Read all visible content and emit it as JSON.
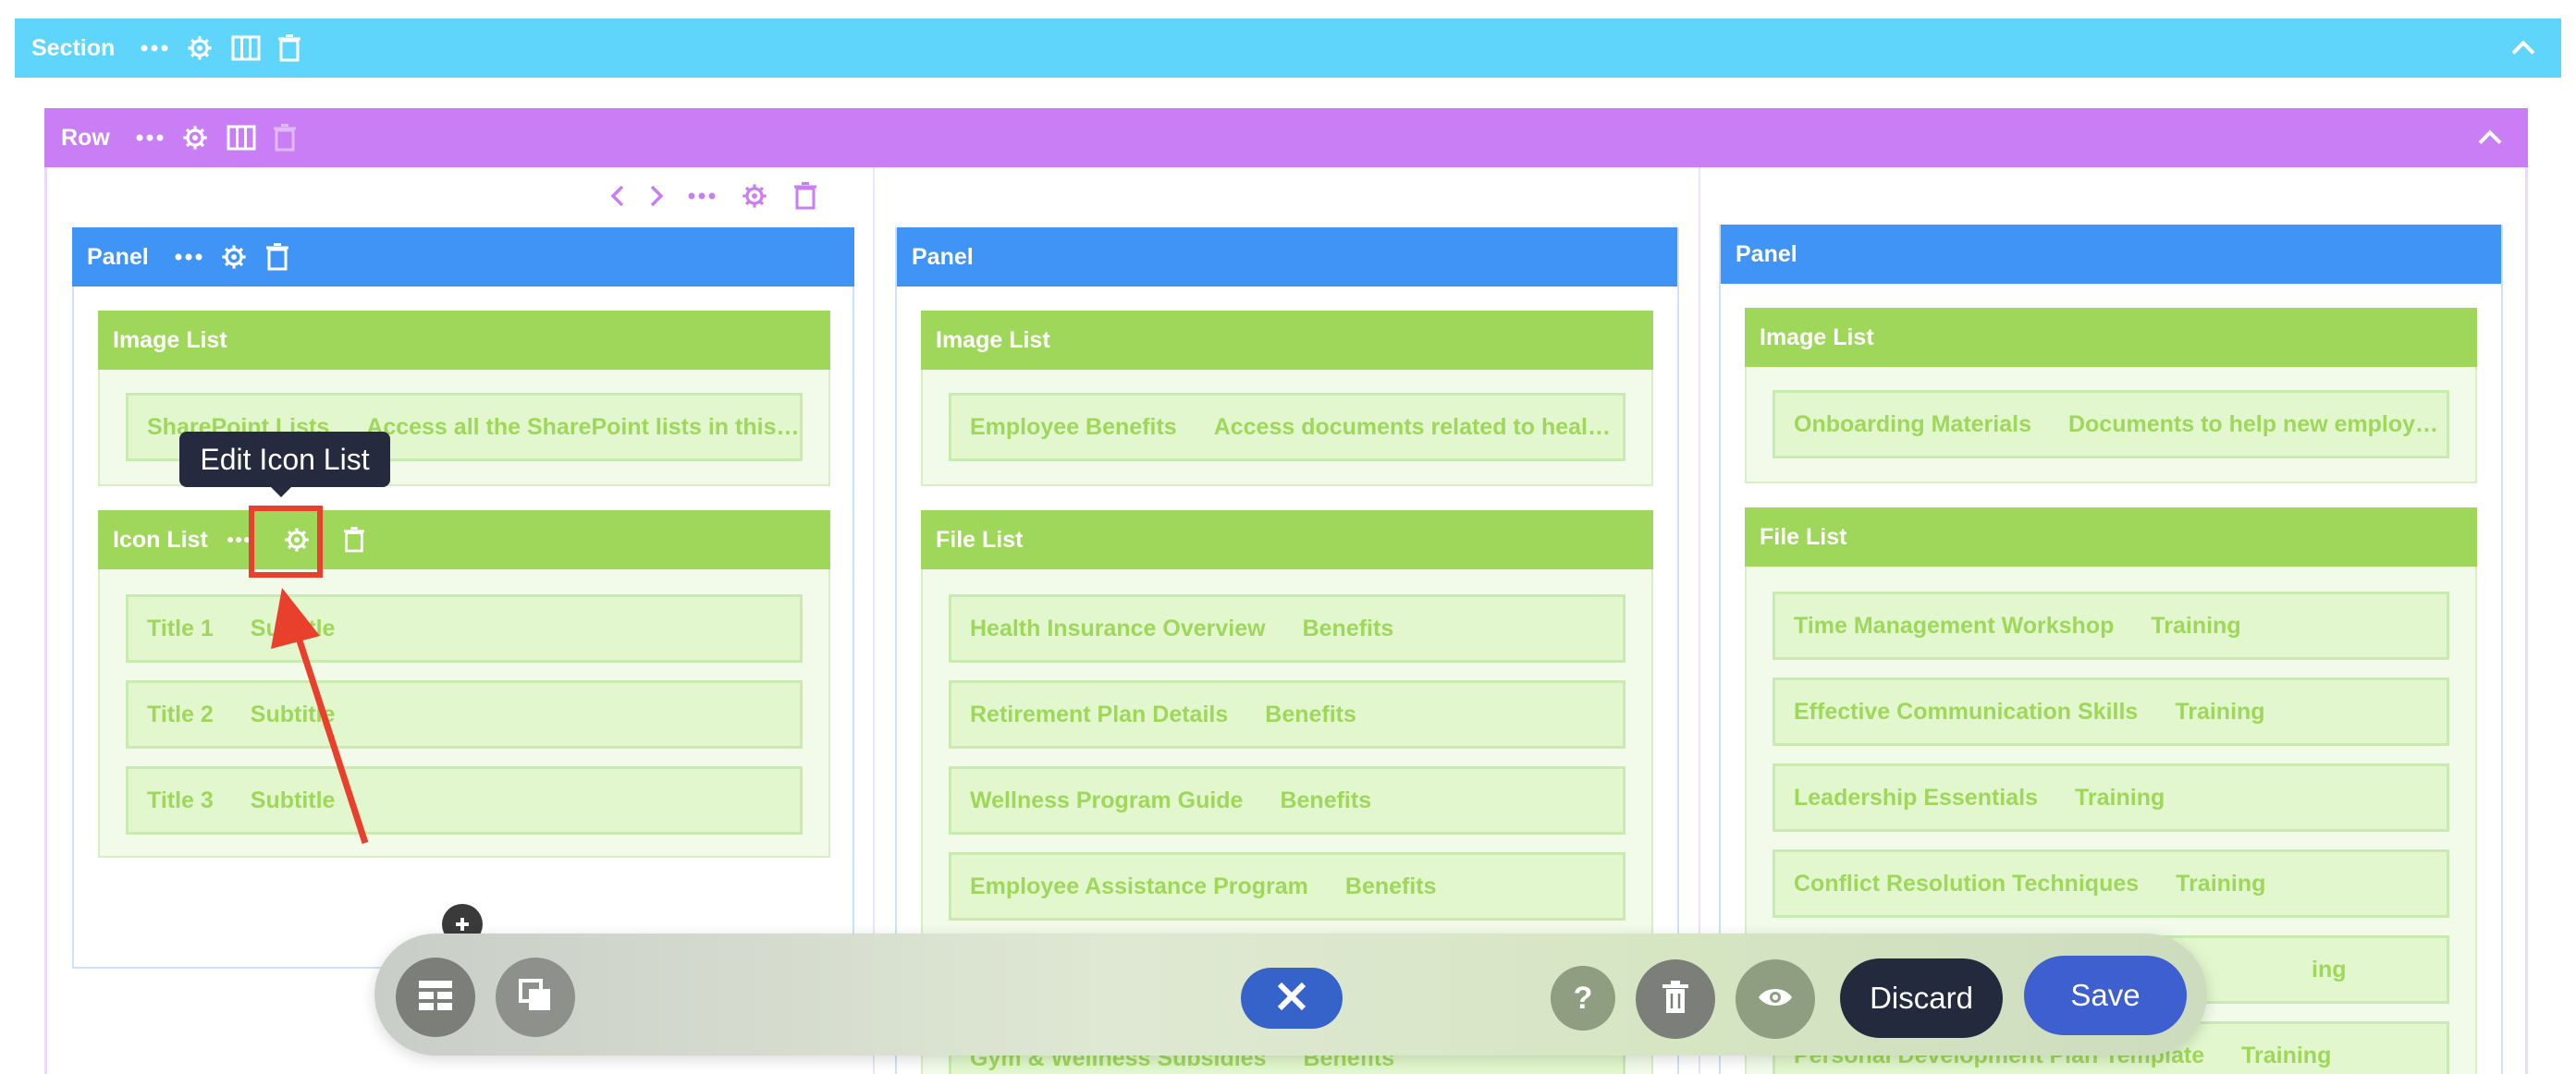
{
  "section": {
    "label": "Section"
  },
  "row": {
    "label": "Row"
  },
  "panels": [
    {
      "label": "Panel",
      "image_list": {
        "label": "Image List",
        "item": {
          "title": "SharePoint Lists",
          "subtitle": "Access all the SharePoint lists in this…"
        }
      },
      "icon_list": {
        "label": "Icon List",
        "items": [
          {
            "title": "Title 1",
            "subtitle": "Subtitle"
          },
          {
            "title": "Title 2",
            "subtitle": "Subtitle"
          },
          {
            "title": "Title 3",
            "subtitle": "Subtitle"
          }
        ]
      }
    },
    {
      "label": "Panel",
      "image_list": {
        "label": "Image List",
        "item": {
          "title": "Employee Benefits",
          "subtitle": "Access documents related to heal…"
        }
      },
      "file_list": {
        "label": "File List",
        "items": [
          {
            "title": "Health Insurance Overview",
            "subtitle": "Benefits"
          },
          {
            "title": "Retirement Plan Details",
            "subtitle": "Benefits"
          },
          {
            "title": "Wellness Program Guide",
            "subtitle": "Benefits"
          },
          {
            "title": "Employee Assistance Program",
            "subtitle": "Benefits"
          },
          {
            "title": "",
            "subtitle": ""
          },
          {
            "title": "Gym & Wellness Subsidies",
            "subtitle": "Benefits"
          }
        ]
      }
    },
    {
      "label": "Panel",
      "image_list": {
        "label": "Image List",
        "item": {
          "title": "Onboarding Materials",
          "subtitle": "Documents to help new employ…"
        }
      },
      "file_list": {
        "label": "File List",
        "items": [
          {
            "title": "Time Management Workshop",
            "subtitle": "Training"
          },
          {
            "title": "Effective Communication Skills",
            "subtitle": "Training"
          },
          {
            "title": "Leadership Essentials",
            "subtitle": "Training"
          },
          {
            "title": "Conflict Resolution Techniques",
            "subtitle": "Training"
          },
          {
            "title": "",
            "subtitle": "ing"
          },
          {
            "title": "Personal Development Plan Template",
            "subtitle": "Training"
          }
        ]
      }
    }
  ],
  "tooltip": {
    "text": "Edit Icon List"
  },
  "toolbar": {
    "discard_label": "Discard",
    "save_label": "Save",
    "help_label": "?"
  },
  "colors": {
    "section": "#5fd5fc",
    "row": "#c97ef6",
    "panel": "#3f94f6",
    "widget": "#9ed75a",
    "highlight": "#e8402c",
    "save": "#3e5fcf",
    "discard": "#232a3e"
  }
}
